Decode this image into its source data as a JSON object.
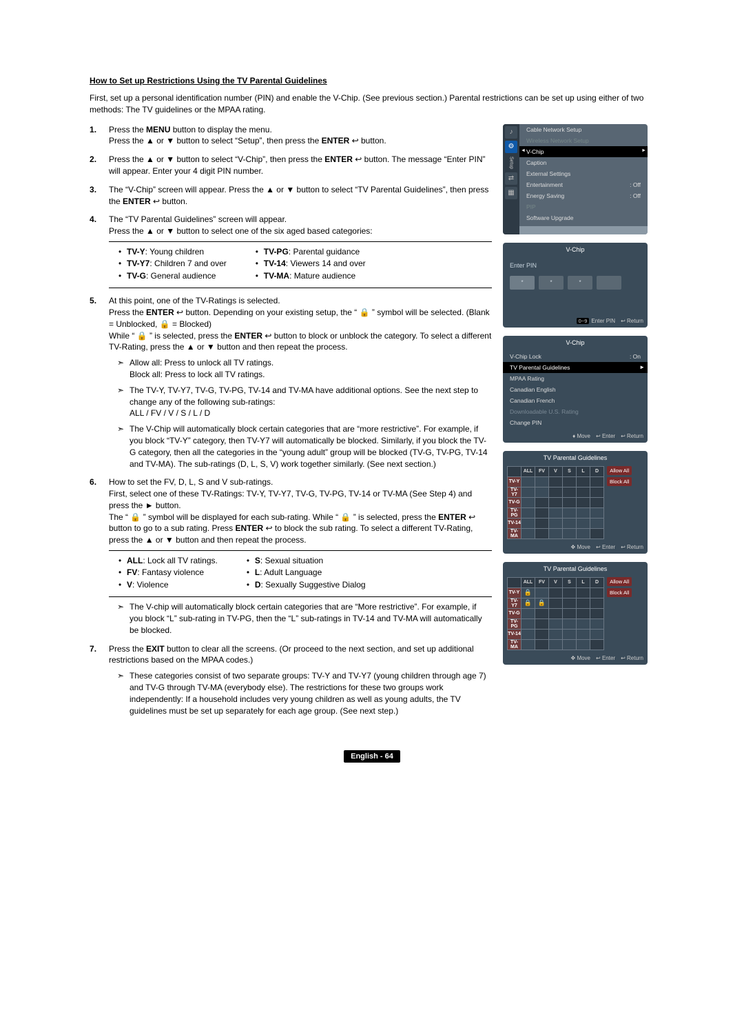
{
  "heading": "How to Set up Restrictions Using the TV Parental Guidelines",
  "intro": "First, set up a personal identification number (PIN) and enable the V-Chip. (See previous section.) Parental restrictions can be set up using either of two methods: The TV guidelines or the MPAA rating.",
  "steps": {
    "s1a": "Press the ",
    "s1a_bold": "MENU",
    "s1b": " button to display the menu.",
    "s1c": "Press the ▲ or ▼ button to select “Setup”, then press the ",
    "s1c_bold": "ENTER",
    "s1d": " button.",
    "s2a": "Press the ▲ or ▼ button to select “V-Chip”, then press the ",
    "s2a_bold": "ENTER",
    "s2b": " button. The message “Enter PIN” will appear. Enter your 4 digit PIN number.",
    "s3a": "The “V-Chip” screen will appear. Press the ▲ or ▼ button to select “TV Parental Guidelines”, then press the ",
    "s3a_bold": "ENTER",
    "s3b": " button.",
    "s4a": "The “TV Parental Guidelines” screen will appear.",
    "s4b": "Press the ▲ or ▼ button to select one of the six aged based categories:",
    "s5a": "At this point, one of the TV-Ratings is selected.",
    "s5b_1": "Press the ",
    "s5b_bold": "ENTER",
    "s5b_2": " button. Depending on your existing setup, the “ ",
    "s5b_3": " ” symbol will be selected. (Blank = Unblocked,  ",
    "s5b_4": " = Blocked)",
    "s5c_1": "While “ ",
    "s5c_2": " ” is selected, press the ",
    "s5c_bold": "ENTER",
    "s5c_3": " button to block or unblock the category. To select a different TV-Rating, press the ▲ or ▼ button and then repeat the process.",
    "s5d": "Allow all: Press to unlock all TV ratings.",
    "s5e": "Block all: Press to lock all TV ratings.",
    "s5f": "The TV-Y, TV-Y7, TV-G, TV-PG, TV-14 and TV-MA have additional options. See the next step to change any of the following sub-ratings:",
    "s5g": "ALL / FV / V / S / L / D",
    "s5h": "The V-Chip will automatically block certain categories that are “more restrictive”. For example, if you block “TV-Y” category, then TV-Y7 will automatically be blocked. Similarly, if you block the TV-G category, then all the categories in the “young adult” group will be blocked (TV-G, TV-PG, TV-14 and TV-MA). The sub-ratings (D, L, S, V) work together similarly. (See next section.)",
    "s6a": "How to set the FV, D, L, S and V sub-ratings.",
    "s6b": "First, select one of these TV-Ratings: TV-Y, TV-Y7, TV-G, TV-PG, TV-14 or TV-MA (See Step 4) and press the ► button.",
    "s6c_1": "The “ ",
    "s6c_2": " ” symbol will be displayed for each sub-rating. While “ ",
    "s6c_3": " ” is selected, press the ",
    "s6c_bold1": "ENTER",
    "s6c_4": " button to go to a sub rating. Press ",
    "s6c_bold2": "ENTER",
    "s6c_5": " to block the sub rating. To select a different TV-Rating, press the ▲ or ▼ button and then repeat the process.",
    "s6d": "The V-chip will automatically block certain categories that are “More restrictive”. For example, if you block “L” sub-rating in TV-PG, then the “L” sub-ratings in TV-14 and TV-MA will automatically be blocked.",
    "s7a_1": "Press the ",
    "s7a_bold": "EXIT",
    "s7a_2": " button to clear all the screens. (Or proceed to the next section, and set up additional restrictions based on the MPAA codes.)",
    "s7b": "These categories consist of two separate groups: TV-Y and TV-Y7 (young children through age 7) and TV-G through TV-MA (everybody else). The restrictions for these two groups work independently: If a household includes very young children as well as young adults, the TV guidelines must be set up separately for each age group. (See next step.)"
  },
  "ratings_left": [
    {
      "b": "TV-Y",
      "t": ": Young children"
    },
    {
      "b": "TV-Y7",
      "t": ": Children 7 and over"
    },
    {
      "b": "TV-G",
      "t": ": General audience"
    }
  ],
  "ratings_right": [
    {
      "b": "TV-PG",
      "t": ": Parental guidance"
    },
    {
      "b": "TV-14",
      "t": ": Viewers 14 and over"
    },
    {
      "b": "TV-MA",
      "t": ": Mature audience"
    }
  ],
  "subratings_left": [
    {
      "b": "ALL",
      "t": ": Lock all TV ratings."
    },
    {
      "b": "FV",
      "t": ": Fantasy violence"
    },
    {
      "b": "V",
      "t": ": Violence"
    }
  ],
  "subratings_right": [
    {
      "b": "S",
      "t": ": Sexual situation"
    },
    {
      "b": "L",
      "t": ": Adult Language"
    },
    {
      "b": "D",
      "t": ": Sexually Suggestive Dialog"
    }
  ],
  "footer": "English - 64",
  "lock_char": "🔒",
  "enter_char": "↩",
  "screens": {
    "setup": {
      "side_label": "Setup",
      "items": [
        {
          "l": "Cable Network Setup",
          "r": "",
          "cls": ""
        },
        {
          "l": "Wireless Network Setup",
          "r": "",
          "cls": "dim"
        },
        {
          "l": "V-Chip",
          "r": "",
          "cls": "sel"
        },
        {
          "l": "Caption",
          "r": "",
          "cls": ""
        },
        {
          "l": "External Settings",
          "r": "",
          "cls": ""
        },
        {
          "l": "Entertainment",
          "r": ": Off",
          "cls": ""
        },
        {
          "l": "Energy Saving",
          "r": ": Off",
          "cls": ""
        },
        {
          "l": "PIP",
          "r": "",
          "cls": "dim"
        },
        {
          "l": "Software Upgrade",
          "r": "",
          "cls": ""
        }
      ]
    },
    "pin": {
      "title": "V-Chip",
      "label": "Enter PIN",
      "star": "*",
      "foot1_key": "0~9",
      "foot1": " Enter PIN",
      "foot2": "↩ Return"
    },
    "vchip": {
      "title": "V-Chip",
      "rows": [
        {
          "l": "V-Chip Lock",
          "r": ": On",
          "cls": ""
        },
        {
          "l": "TV Parental Guidelines",
          "r": "",
          "cls": "sel"
        },
        {
          "l": "MPAA Rating",
          "r": "",
          "cls": ""
        },
        {
          "l": "Canadian English",
          "r": "",
          "cls": ""
        },
        {
          "l": "Canadian French",
          "r": "",
          "cls": ""
        },
        {
          "l": "Downloadable U.S. Rating",
          "r": "",
          "cls": "dim"
        },
        {
          "l": "Change PIN",
          "r": "",
          "cls": ""
        }
      ],
      "foot_move": "♦ Move",
      "foot_enter": "↩ Enter",
      "foot_return": "↩ Return"
    },
    "pg": {
      "title": "TV Parental Guidelines",
      "cols": [
        "ALL",
        "FV",
        "V",
        "S",
        "L",
        "D"
      ],
      "rows": [
        "TV-Y",
        "TV-Y7",
        "TV-G",
        "TV-PG",
        "TV-14",
        "TV-MA"
      ],
      "allow": "Allow All",
      "block": "Block All",
      "foot_move": "✥ Move",
      "foot_enter": "↩ Enter",
      "foot_return": "↩ Return"
    }
  }
}
